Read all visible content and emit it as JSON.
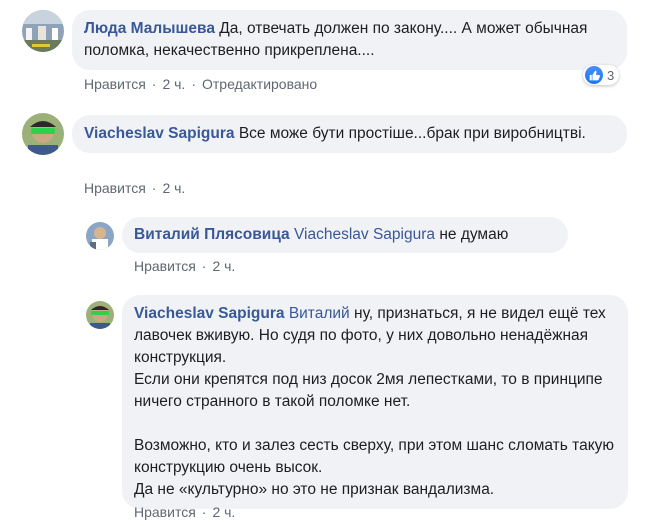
{
  "comments": [
    {
      "author": "Люда Малышева",
      "text": "Да, отвечать должен по закону.... А может обычная поломка, некачественно прикреплена....",
      "like": "Нравится",
      "time": "2 ч.",
      "edited": "Отредактировано",
      "reactions_count": "3"
    },
    {
      "author": "Viacheslav Sapigura",
      "text": "Все може бути простіше...брак при виробництві.",
      "like": "Нравится",
      "time": "2 ч."
    }
  ],
  "replies": [
    {
      "author": "Виталий Плясовица",
      "mention": "Viacheslav Sapigura",
      "text": "не думаю",
      "like": "Нравится",
      "time": "2 ч."
    },
    {
      "author": "Viacheslav Sapigura",
      "mention": "Виталий",
      "text_p1": "ну, признаться, я не видел ещё тех лавочек вживую. Но судя по фото, у них довольно ненадёжная конструкция.",
      "text_p2": "Если они крепятся под низ досок 2мя лепестками, то в принципе ничего странного в такой поломке нет.",
      "text_p3": "Возможно, кто и залез сесть сверху, при этом шанс сломать такую конструкцию очень высок.",
      "text_p4": "Да не «культурно» но это не признак вандализма.",
      "like": "Нравится",
      "time": "2 ч."
    }
  ],
  "colors": {
    "author": "#385898",
    "bubble": "#f0f2f5",
    "meta": "#606770",
    "like": "#1877f2"
  }
}
